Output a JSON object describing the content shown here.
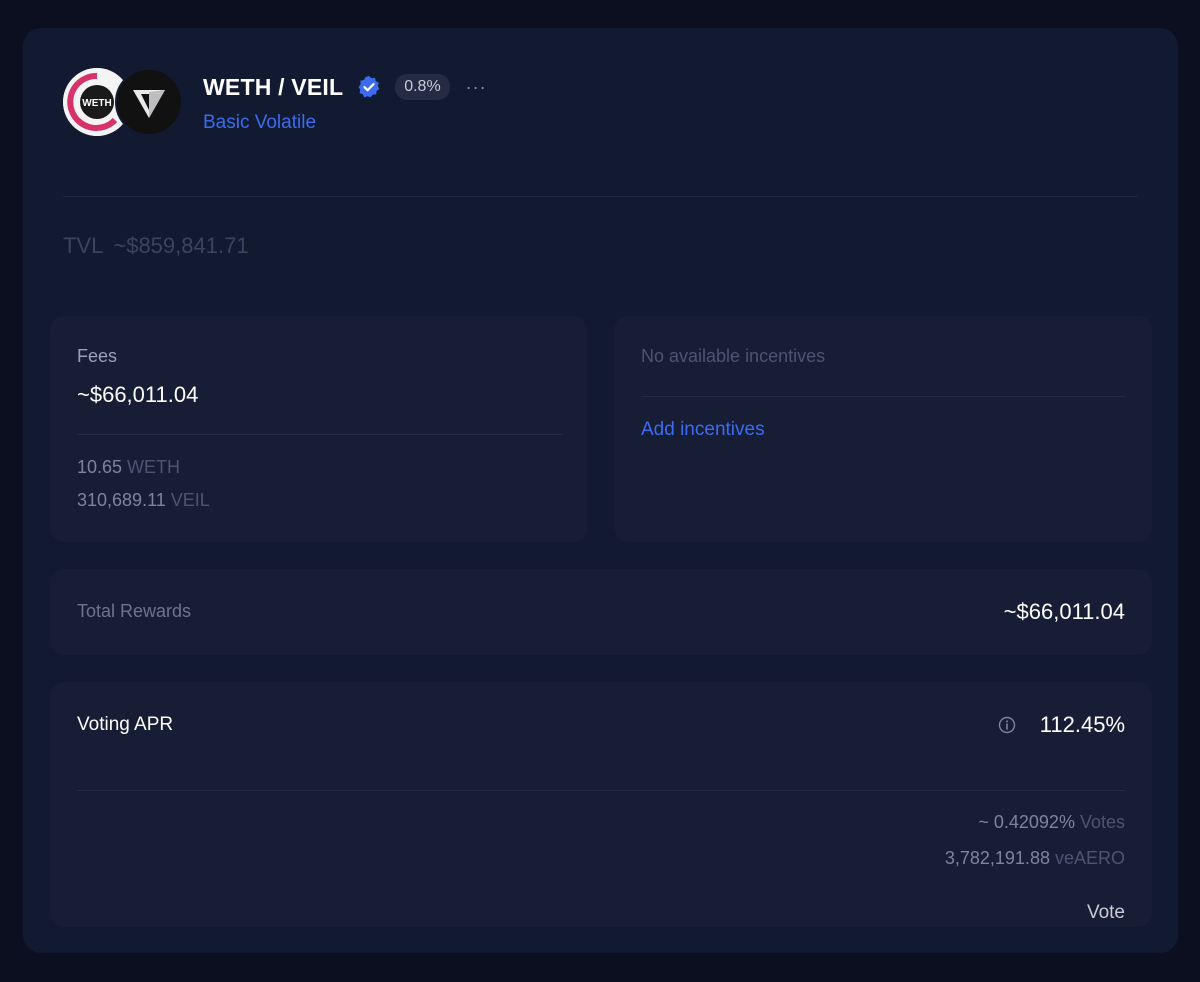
{
  "pool": {
    "token_a_symbol": "WETH",
    "pair_title": "WETH / VEIL",
    "fee_badge": "0.8%",
    "more_label": "···",
    "pool_type": "Basic Volatile"
  },
  "tvl": {
    "label": "TVL",
    "value": "~$859,841.71"
  },
  "fees": {
    "label": "Fees",
    "total": "~$66,011.04",
    "tokens": [
      {
        "amount": "10.65",
        "symbol": "WETH"
      },
      {
        "amount": "310,689.11",
        "symbol": "VEIL"
      }
    ]
  },
  "incentives": {
    "empty_label": "No available incentives",
    "add_label": "Add incentives"
  },
  "rewards": {
    "label": "Total Rewards",
    "value": "~$66,011.04"
  },
  "voting": {
    "label": "Voting APR",
    "apr": "112.45%",
    "votes_pct": "~ 0.42092%",
    "votes_label": "Votes",
    "ve_amount": "3,782,191.88",
    "ve_symbol": "veAERO",
    "vote_button": "Vote"
  },
  "colors": {
    "accent": "#3b6cf0",
    "card_bg": "#121a31",
    "panel_bg": "#171d35"
  },
  "icons": [
    "weth-token-icon",
    "veil-token-icon",
    "verified-badge-icon",
    "info-icon"
  ]
}
